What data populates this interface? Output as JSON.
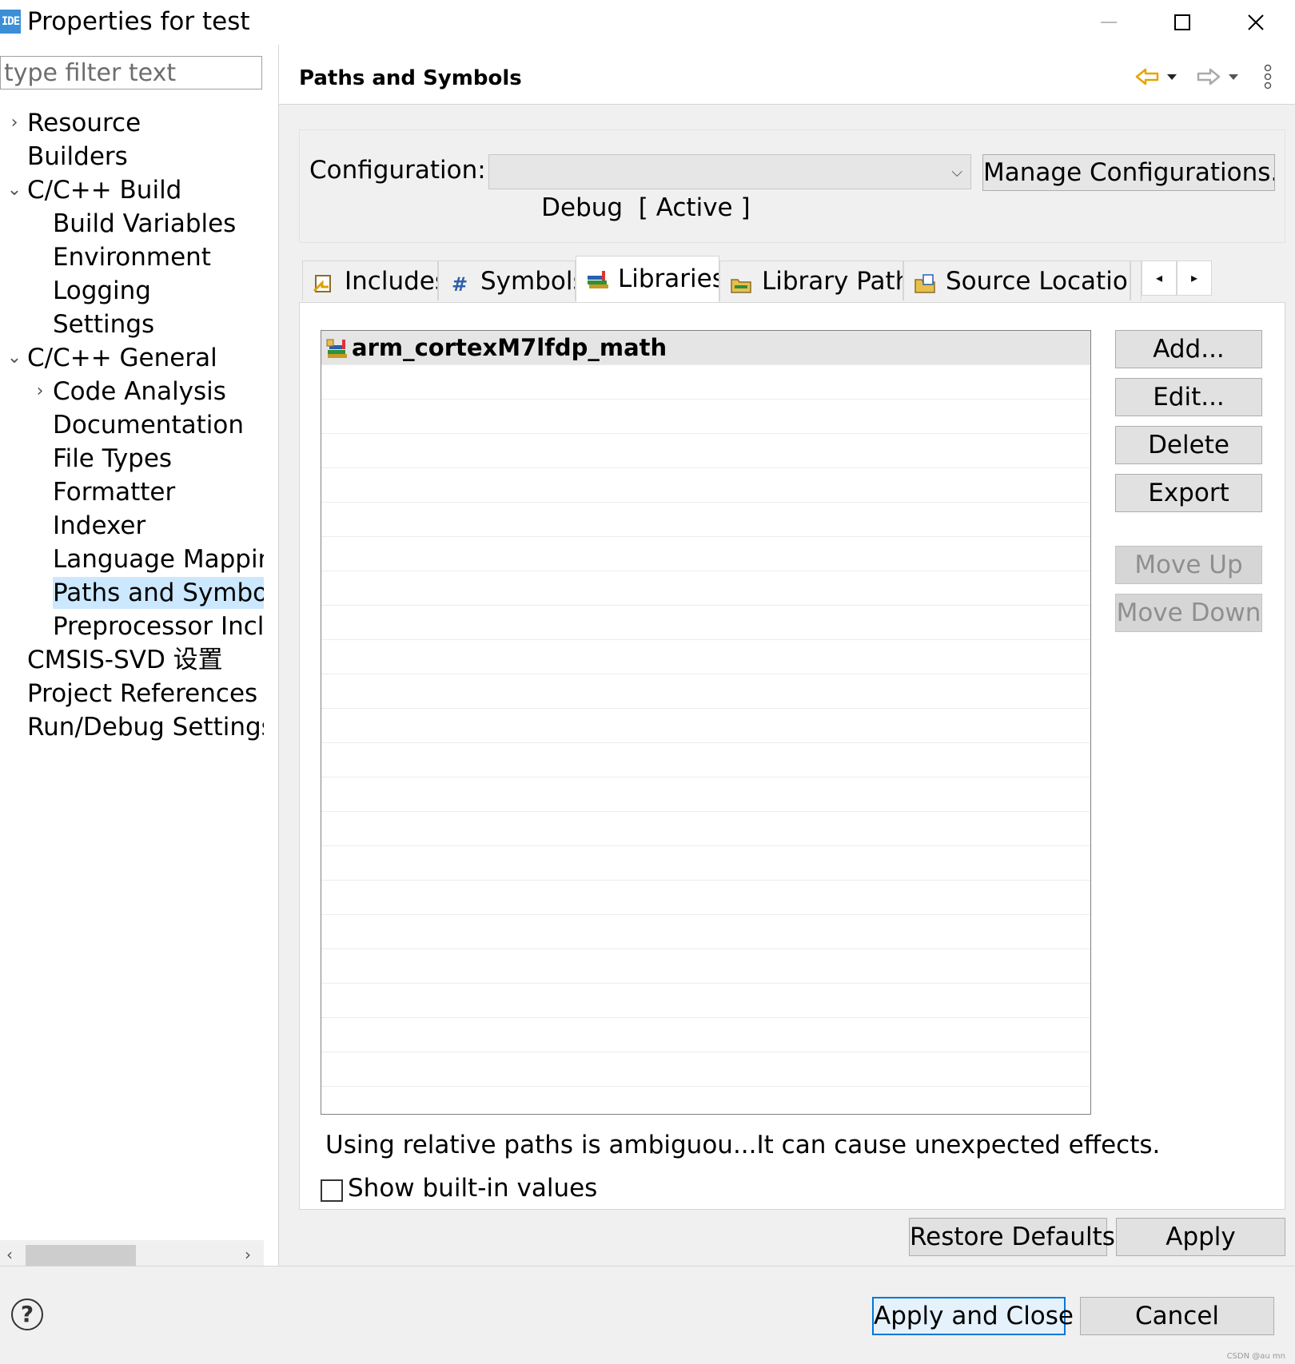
{
  "window": {
    "app_icon_text": "IDE",
    "title": "Properties for test",
    "minimize_icon": "minimize-icon",
    "maximize_icon": "maximize-icon",
    "close_icon": "close-icon"
  },
  "sidebar": {
    "filter_placeholder": "type filter text",
    "items": [
      {
        "label": "Resource",
        "level": 0,
        "expander": "collapsed"
      },
      {
        "label": "Builders",
        "level": 0,
        "expander": "none"
      },
      {
        "label": "C/C++ Build",
        "level": 0,
        "expander": "expanded"
      },
      {
        "label": "Build Variables",
        "level": 1,
        "expander": "none"
      },
      {
        "label": "Environment",
        "level": 1,
        "expander": "none"
      },
      {
        "label": "Logging",
        "level": 1,
        "expander": "none"
      },
      {
        "label": "Settings",
        "level": 1,
        "expander": "none"
      },
      {
        "label": "C/C++ General",
        "level": 0,
        "expander": "expanded"
      },
      {
        "label": "Code Analysis",
        "level": 1,
        "expander": "collapsed"
      },
      {
        "label": "Documentation",
        "level": 1,
        "expander": "none"
      },
      {
        "label": "File Types",
        "level": 1,
        "expander": "none"
      },
      {
        "label": "Formatter",
        "level": 1,
        "expander": "none"
      },
      {
        "label": "Indexer",
        "level": 1,
        "expander": "none"
      },
      {
        "label": "Language Mappings",
        "level": 1,
        "expander": "none"
      },
      {
        "label": "Paths and Symbols",
        "level": 1,
        "expander": "none",
        "selected": true
      },
      {
        "label": "Preprocessor Include Paths, Macros etc.",
        "level": 1,
        "expander": "none"
      },
      {
        "label": "CMSIS-SVD 设置",
        "level": 0,
        "expander": "none"
      },
      {
        "label": "Project References",
        "level": 0,
        "expander": "none"
      },
      {
        "label": "Run/Debug Settings",
        "level": 0,
        "expander": "none"
      }
    ]
  },
  "header": {
    "title": "Paths and Symbols",
    "back_icon": "back-arrow-icon",
    "forward_icon": "forward-arrow-icon",
    "menu_icon": "vertical-ellipsis-icon"
  },
  "config": {
    "label": "Configuration:",
    "selected": "Debug  [ Active ]",
    "manage_label": "Manage Configurations..."
  },
  "tabs": [
    {
      "label": "Includes",
      "icon": "includes-icon"
    },
    {
      "label": "Symbols",
      "icon": "hash-icon"
    },
    {
      "label": "Libraries",
      "icon": "libraries-icon",
      "active": true
    },
    {
      "label": "Library Paths",
      "icon": "library-paths-icon"
    },
    {
      "label": "Source Location",
      "icon": "source-location-icon"
    }
  ],
  "libraries": {
    "items": [
      "arm_cortexM7lfdp_math"
    ],
    "buttons": {
      "add": "Add...",
      "edit": "Edit...",
      "delete": "Delete",
      "export": "Export",
      "move_up": "Move Up",
      "move_down": "Move Down"
    },
    "warning": "Using relative paths is ambiguou...It can cause unexpected effects.",
    "show_builtin_label": "Show built-in values",
    "show_builtin_checked": false
  },
  "page_buttons": {
    "restore_defaults": "Restore Defaults",
    "apply": "Apply"
  },
  "footer": {
    "help_icon": "help-icon",
    "apply_close": "Apply and Close",
    "cancel": "Cancel",
    "watermark": "CSDN @au mn"
  },
  "colors": {
    "selection": "#cce8ff",
    "default_button_border": "#0078d7",
    "app_icon": "#3b8fd6",
    "nav_arrow": "#e8a200"
  }
}
